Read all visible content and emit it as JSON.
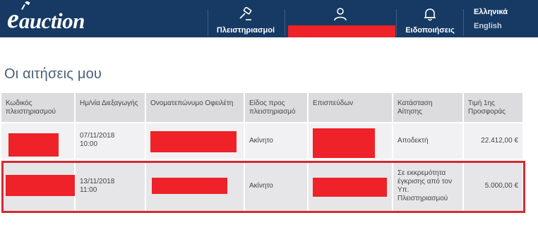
{
  "brand": {
    "logo_e": "e",
    "logo_word": "auction"
  },
  "nav": {
    "auctions_label": "Πλειστηριασμοί",
    "notifications_label": "Ειδοποιήσεις",
    "profile_label": ""
  },
  "languages": {
    "greek": "Ελληνικά",
    "english": "English"
  },
  "page": {
    "title": "Οι αιτήσεις μου"
  },
  "table": {
    "headers": [
      "Κωδικός πλειστηριασμού",
      "Ημ/νία Διεξαγωγής",
      "Ονοματεπώνυμο Οφειλέτη",
      "Είδος προς πλειστηριασμό",
      "Επισπεύδων",
      "Κατάσταση Αίτησης",
      "Τιμή 1ης Προσφοράς"
    ],
    "rows": [
      {
        "date": "07/11/2018\n10:00",
        "type": "Ακίνητο",
        "status": "Αποδεκτή",
        "price": "22.412,00 €"
      },
      {
        "date": "13/11/2018\n11:00",
        "type": "Ακίνητο",
        "status": "Σε εκκρεμότητα έγκρισης από τον Υπ. Πλειστηριασμού",
        "price": "5.000,00 €"
      }
    ]
  },
  "colors": {
    "topbar": "#163a63",
    "redaction": "#ee2228",
    "highlight": "#d42a32",
    "title": "#4a5f78"
  },
  "icons": {
    "auctions": "gavel-icon",
    "profile": "user-icon",
    "notifications": "bell-icon"
  }
}
